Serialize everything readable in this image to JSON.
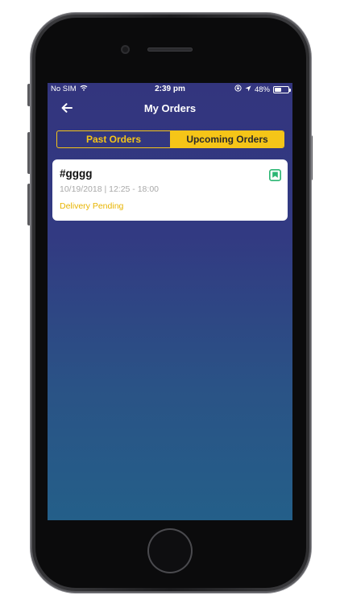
{
  "status_bar": {
    "carrier": "No SIM",
    "time": "2:39 pm",
    "battery_percent": "48%",
    "battery_level": 0.48,
    "icons": [
      "wifi-icon",
      "orientation-lock-icon",
      "location-arrow-icon",
      "battery-icon"
    ]
  },
  "nav": {
    "title": "My Orders",
    "back_icon": "arrow-left-icon"
  },
  "segment": {
    "past_label": "Past Orders",
    "upcoming_label": "Upcoming Orders",
    "selected": "upcoming"
  },
  "orders": [
    {
      "id": "#gggg",
      "datetime": "10/19/2018 | 12:25 - 18:00",
      "status": "Delivery Pending",
      "icon": "order-type-icon"
    }
  ],
  "colors": {
    "accent": "#f5c518",
    "status_pending": "#e8b400",
    "order_icon": "#2bb673",
    "screen_top": "#33357e",
    "screen_bottom": "#245f89"
  }
}
